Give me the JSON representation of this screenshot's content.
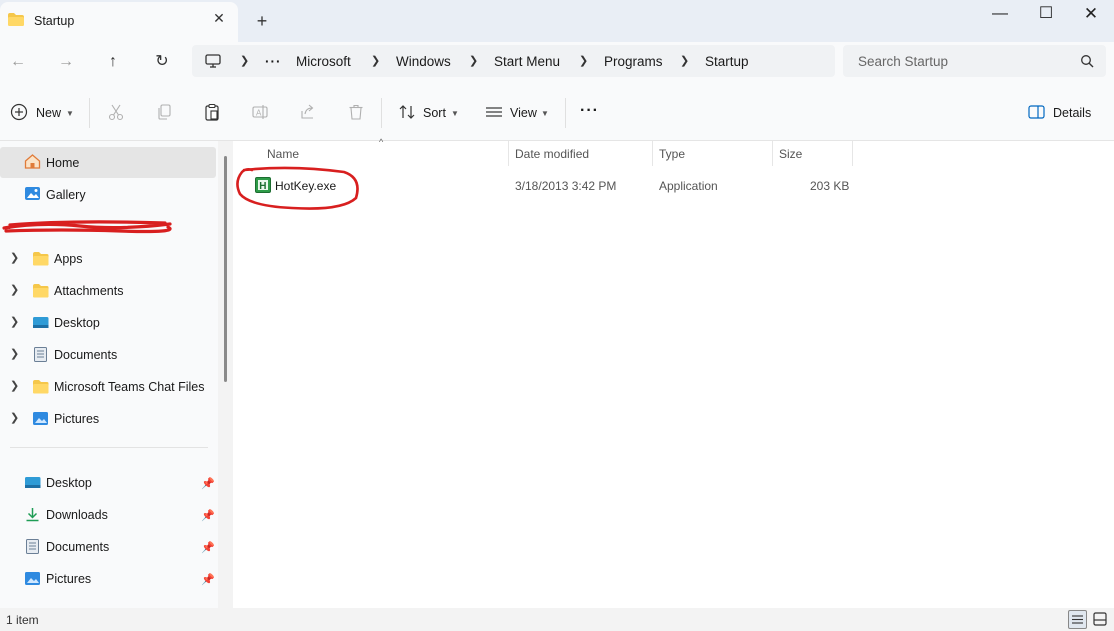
{
  "window": {
    "tab_title": "Startup",
    "tab_close": "✕",
    "new_tab": "+",
    "minimize": "—",
    "maximize": "☐",
    "close": "✕"
  },
  "nav": {
    "back": "←",
    "forward": "→",
    "up": "↑",
    "refresh": "↻",
    "overflow": "···",
    "breadcrumbs": [
      "Microsoft",
      "Windows",
      "Start Menu",
      "Programs",
      "Startup"
    ],
    "search_placeholder": "Search Startup"
  },
  "commands": {
    "new": "New",
    "sort": "Sort",
    "view": "View",
    "more": "···",
    "details": "Details"
  },
  "sidebar": {
    "top": [
      {
        "label": "Home",
        "icon": "home-icon",
        "selected": true
      },
      {
        "label": "Gallery",
        "icon": "gallery-icon"
      }
    ],
    "tree": [
      {
        "label": "Apps",
        "icon": "folder-icon"
      },
      {
        "label": "Attachments",
        "icon": "folder-icon"
      },
      {
        "label": "Desktop",
        "icon": "desktop-icon"
      },
      {
        "label": "Documents",
        "icon": "documents-icon"
      },
      {
        "label": "Microsoft Teams Chat Files",
        "icon": "folder-icon"
      },
      {
        "label": "Pictures",
        "icon": "pictures-icon"
      }
    ],
    "quick_access": [
      {
        "label": "Desktop",
        "icon": "desktop-icon"
      },
      {
        "label": "Downloads",
        "icon": "download-icon"
      },
      {
        "label": "Documents",
        "icon": "documents-icon"
      },
      {
        "label": "Pictures",
        "icon": "pictures-icon"
      }
    ]
  },
  "columns": [
    "Name",
    "Date modified",
    "Type",
    "Size"
  ],
  "files": [
    {
      "name": "HotKey.exe",
      "date_modified": "3/18/2013 3:42 PM",
      "type": "Application",
      "size": "203 KB"
    }
  ],
  "status": {
    "text": "1 item"
  },
  "colors": {
    "accent": "#0067c0",
    "annotation": "#d81f1f",
    "folder": "#f5c74a"
  }
}
